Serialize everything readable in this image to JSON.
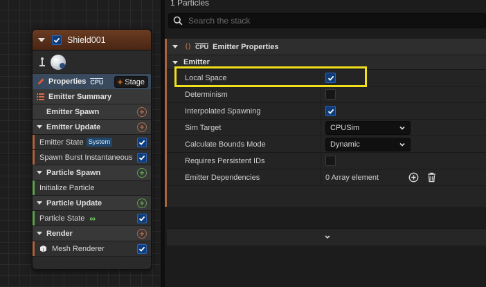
{
  "graph": {
    "node": {
      "title": "Shield001",
      "properties_label": "Properties",
      "cpu_badge": "CPU",
      "stage_label": "Stage",
      "rows": [
        {
          "kind": "section-icon",
          "label": "Emitter Summary"
        },
        {
          "kind": "plain",
          "label": "Emitter Spawn",
          "add": true,
          "add_color": "orange"
        },
        {
          "kind": "section",
          "label": "Emitter Update",
          "add": true,
          "add_color": "orange"
        },
        {
          "kind": "item",
          "label": "Emitter State",
          "badge": "System",
          "checked": true,
          "stripe": "#b0603c"
        },
        {
          "kind": "item",
          "label": "Spawn Burst Instantaneous",
          "checked": true,
          "stripe": "#b0603c"
        },
        {
          "kind": "section",
          "label": "Particle Spawn",
          "add": true,
          "add_color": "green"
        },
        {
          "kind": "item",
          "label": "Initialize Particle",
          "checked": false,
          "stripe": "#5da24b"
        },
        {
          "kind": "section",
          "label": "Particle Update",
          "add": true,
          "add_color": "green"
        },
        {
          "kind": "item",
          "label": "Particle State",
          "badge": "∞",
          "checked": true,
          "stripe": "#5da24b"
        },
        {
          "kind": "section",
          "label": "Render",
          "add": true,
          "add_color": "orange"
        },
        {
          "kind": "item",
          "label": "Mesh Renderer",
          "checked": true,
          "stripe": "#b0603c",
          "mesh_icon": true
        }
      ]
    }
  },
  "panel": {
    "particle_count": "1 Particles",
    "search_placeholder": "Search the stack",
    "section_title": "Emitter Properties",
    "section_cpu": "CPU",
    "category": "Emitter",
    "properties": [
      {
        "label": "Local Space",
        "type": "checkbox",
        "checked": true
      },
      {
        "label": "Determinism",
        "type": "checkbox",
        "checked": false
      },
      {
        "label": "Interpolated Spawning",
        "type": "checkbox",
        "checked": true
      },
      {
        "label": "Sim Target",
        "type": "dropdown",
        "value": "CPUSim"
      },
      {
        "label": "Calculate Bounds Mode",
        "type": "dropdown",
        "value": "Dynamic"
      },
      {
        "label": "Requires Persistent IDs",
        "type": "checkbox",
        "checked": false
      },
      {
        "label": "Emitter Dependencies",
        "type": "array",
        "value": "0 Array element"
      }
    ]
  },
  "colors": {
    "accent_orange": "#f07b21",
    "highlight_yellow": "#f0df1a",
    "check_blue": "#0e3c7a"
  }
}
